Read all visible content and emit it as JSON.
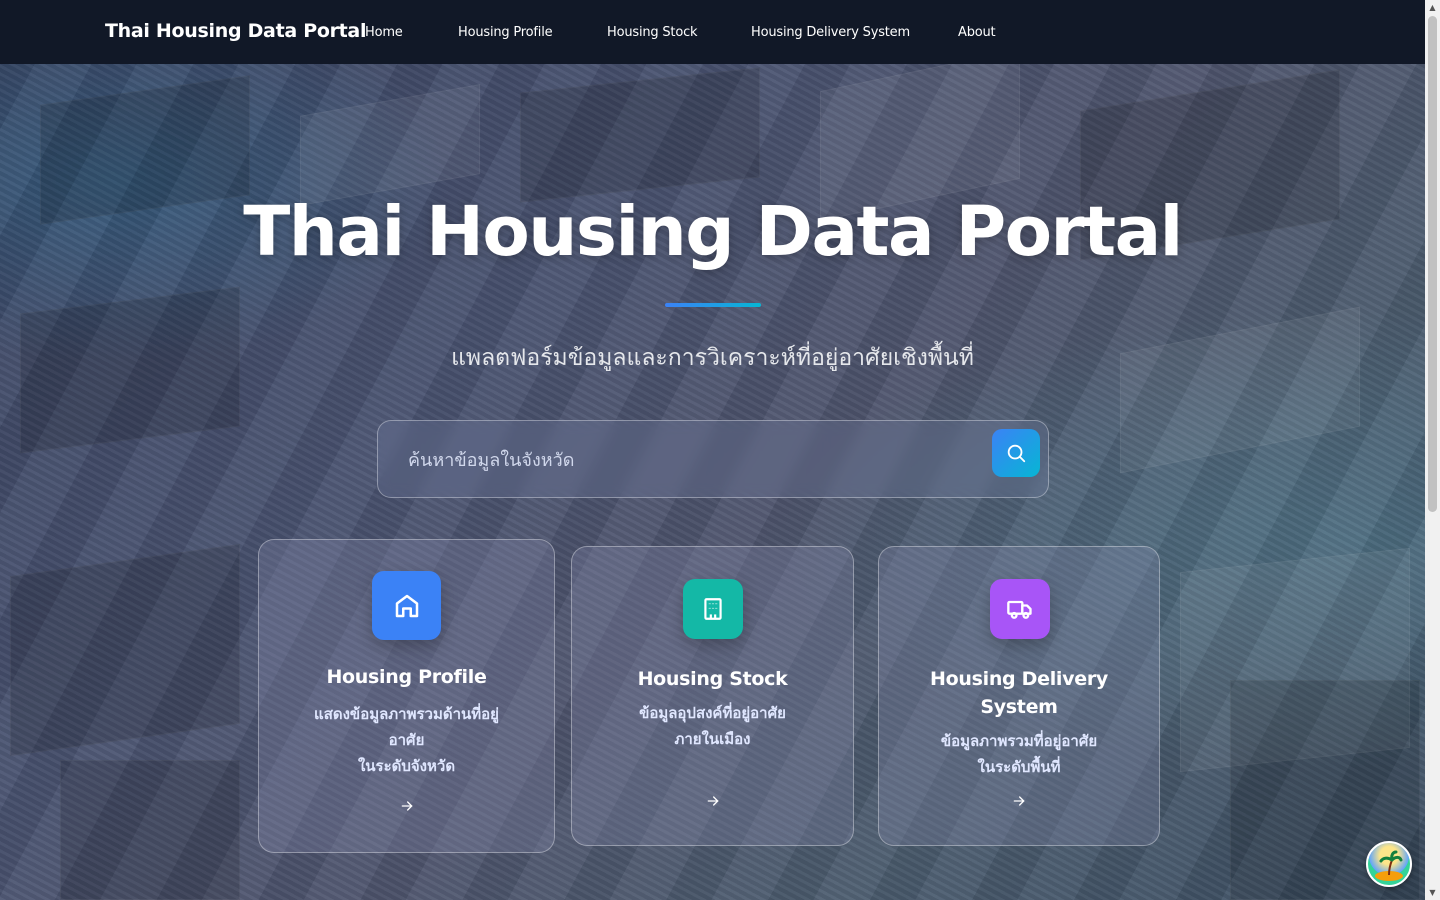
{
  "nav": {
    "brand": "Thai Housing Data Portal",
    "links": [
      "Home",
      "Housing Profile",
      "Housing Stock",
      "Housing Delivery System",
      "About"
    ]
  },
  "hero": {
    "title": "Thai Housing Data Portal",
    "subtitle": "แพลตฟอร์มข้อมูลและการวิเคราะห์ที่อยู่อาศัยเชิงพื้นที่"
  },
  "search": {
    "placeholder": "ค้นหาข้อมูลในจังหวัด",
    "value": ""
  },
  "cards": [
    {
      "title": "Housing Profile",
      "desc_lines": [
        "แสดงข้อมูลภาพรวมด้านที่อยู่",
        "อาศัย",
        "ในระดับจังหวัด"
      ],
      "icon": "home-icon",
      "color": "#3b82f6"
    },
    {
      "title": "Housing Stock",
      "desc_lines": [
        "ข้อมูลอุปสงค์ที่อยู่อาศัย",
        "ภายในเมือง"
      ],
      "icon": "building-icon",
      "color": "#14b8a6"
    },
    {
      "title_lines": [
        "Housing Delivery",
        "System"
      ],
      "desc_lines": [
        "ข้อมูลภาพรวมที่อยู่อาศัย",
        "ในระดับพื้นที่"
      ],
      "icon": "truck-icon",
      "color": "#a855f7"
    }
  ],
  "colors": {
    "nav_bg": "#111827",
    "accent_gradient_start": "#3b82f6",
    "accent_gradient_end": "#06b6d4"
  }
}
